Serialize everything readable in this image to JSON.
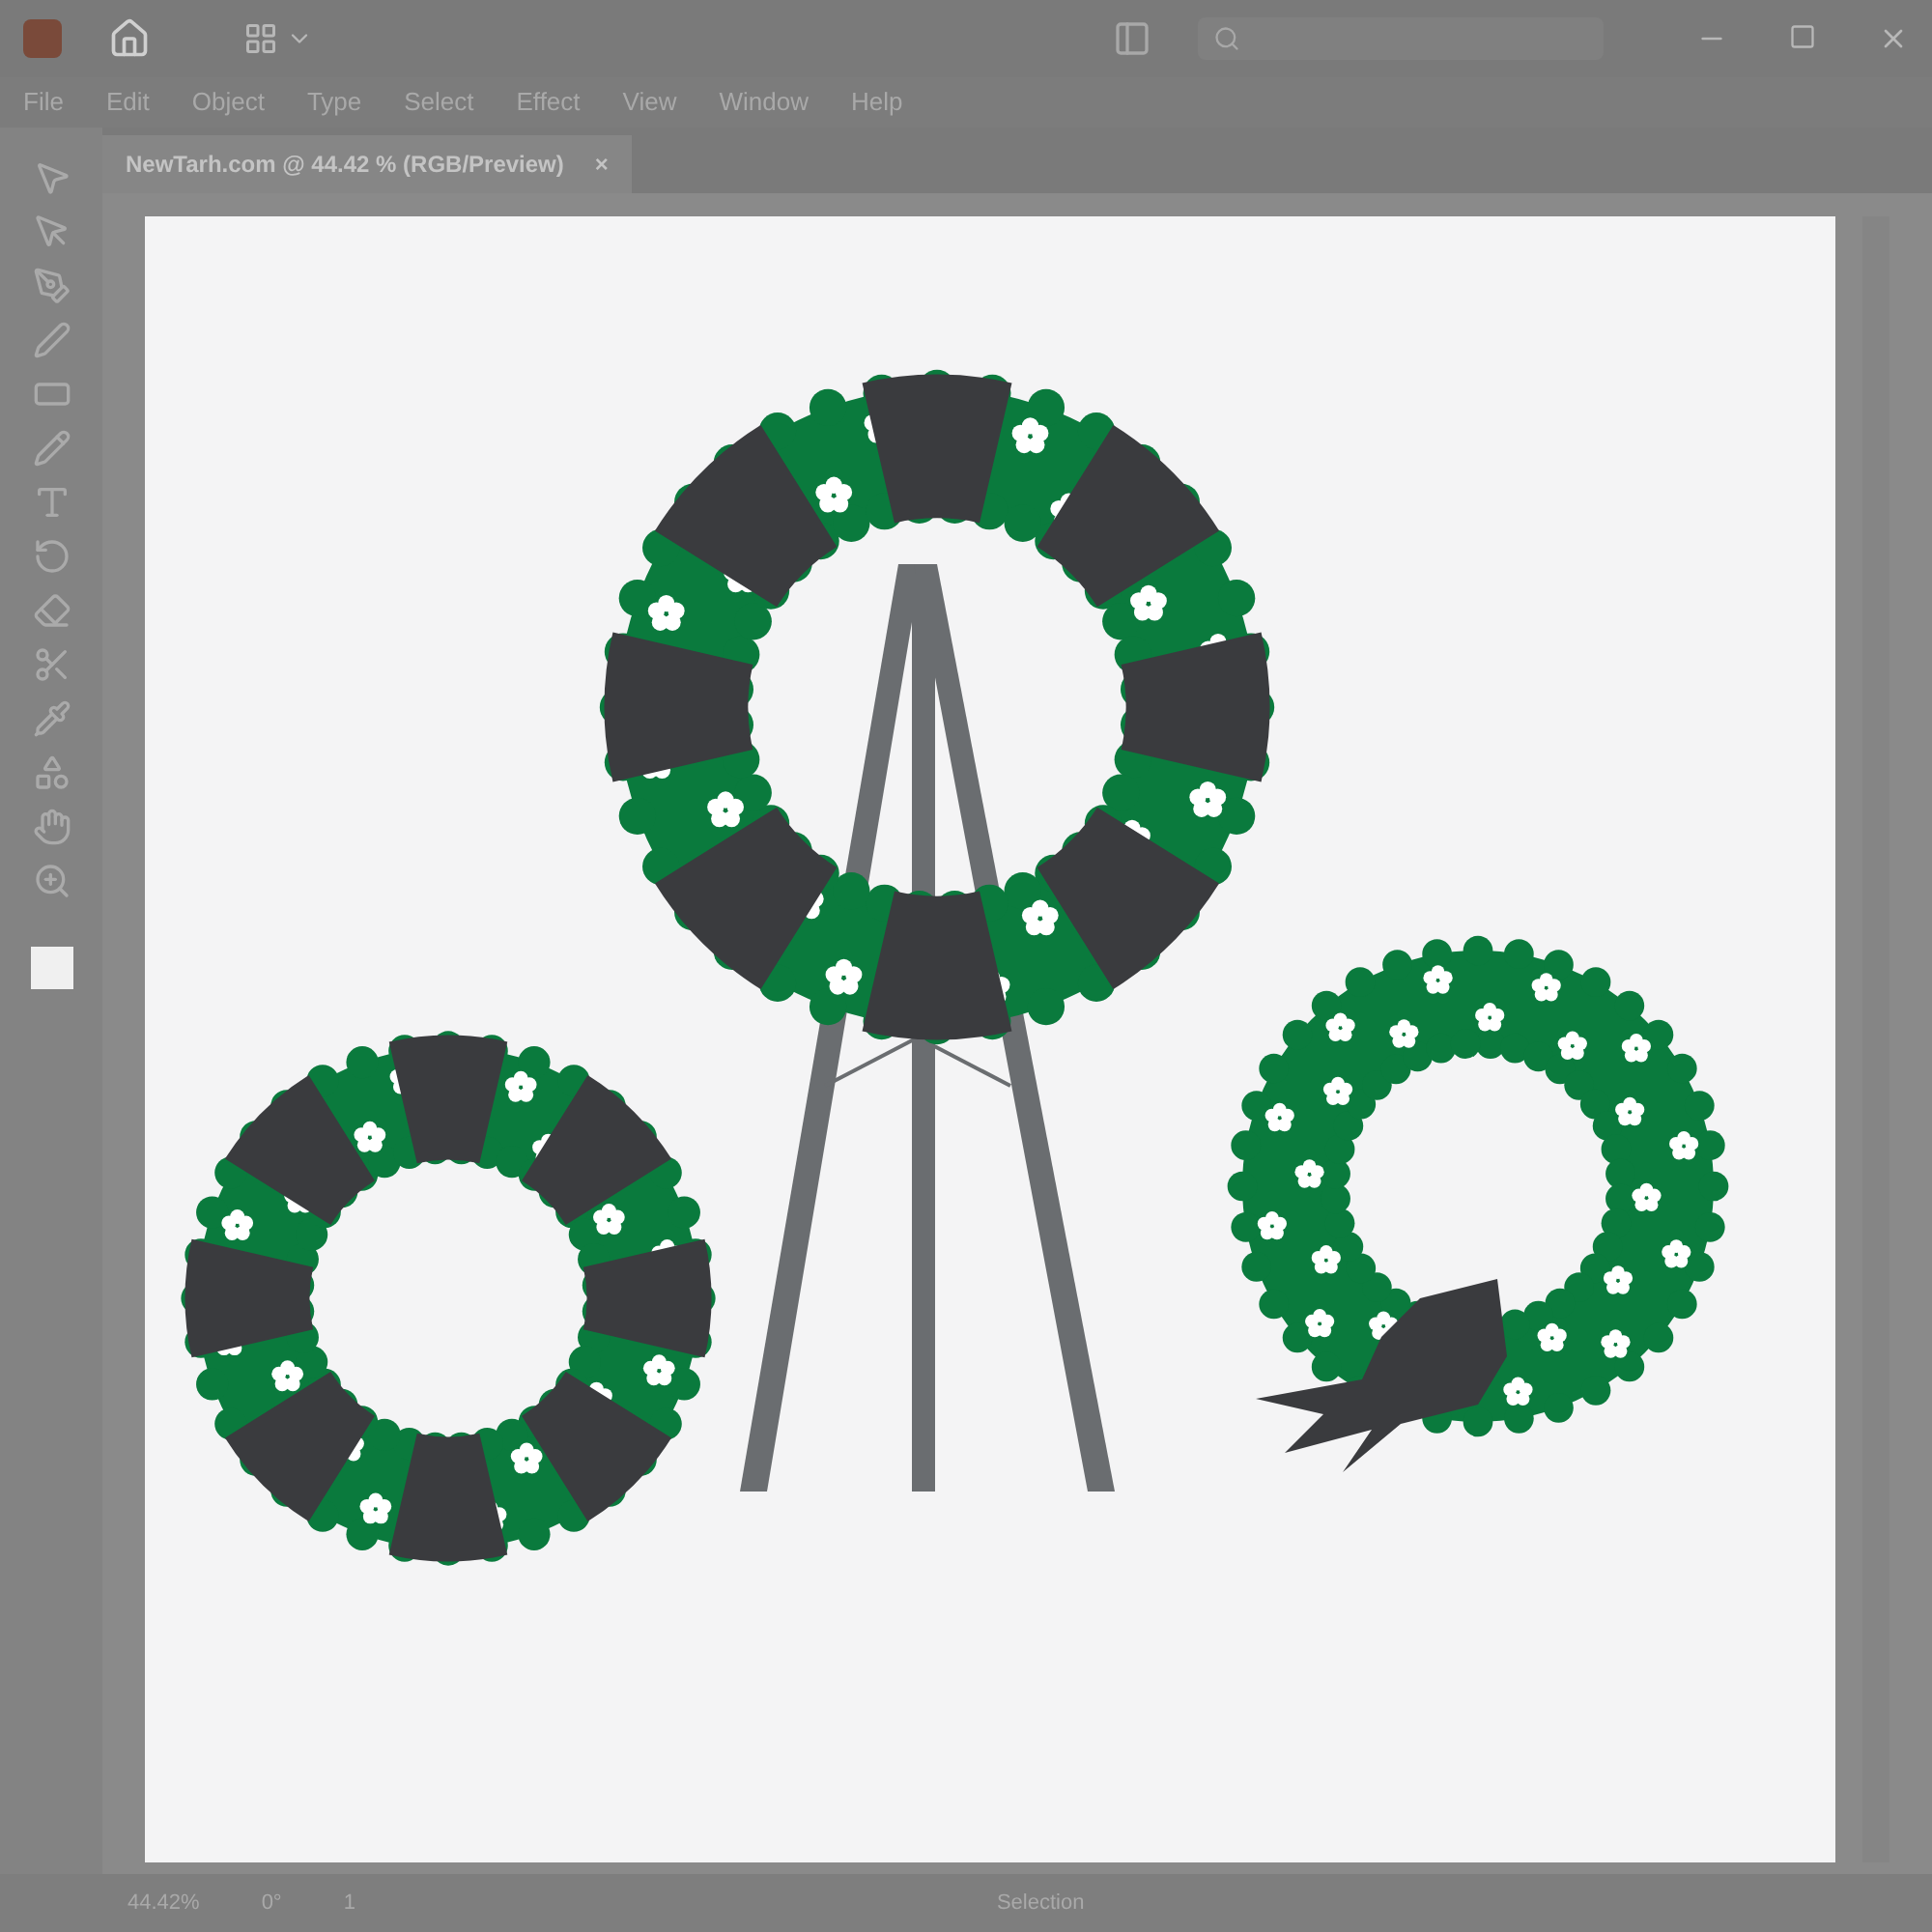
{
  "menu": [
    "File",
    "Edit",
    "Object",
    "Type",
    "Select",
    "Effect",
    "View",
    "Window",
    "Help"
  ],
  "document_tab": {
    "title": "NewTarh.com @ 44.42 % (RGB/Preview)",
    "close": "×"
  },
  "status_bar": {
    "zoom": "44.42%",
    "rotation": "0°",
    "artboard": "1",
    "tool": "Selection"
  }
}
